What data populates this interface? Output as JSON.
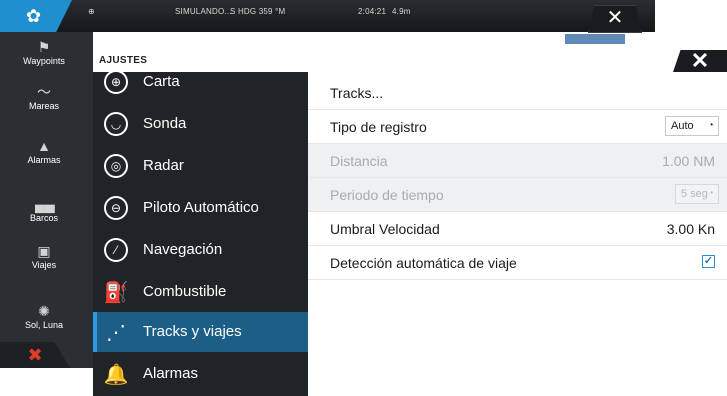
{
  "topbar": {
    "home_icon": "gear-icon",
    "gps_icon": "globe-icon",
    "mode": "SIMULANDO...",
    "hdg_label": "S HDG 359 °M",
    "time": "2:04:21",
    "speed": "4.9m",
    "close_icon": "close-icon"
  },
  "sidebar": {
    "items": [
      {
        "label": "Waypoints",
        "icon": "flag-icon"
      },
      {
        "label": "Mareas",
        "icon": "wave-icon"
      },
      {
        "label": "Alarmas",
        "icon": "bell-icon"
      },
      {
        "label": "Barcos",
        "icon": "ship-icon"
      },
      {
        "label": "Viajes",
        "icon": "trip-icon"
      },
      {
        "label": "Sol, Luna",
        "icon": "sun-icon"
      }
    ],
    "exit_icon": "close-red-icon"
  },
  "dialog": {
    "title": "AJUSTES",
    "close_icon": "close-icon",
    "menu": [
      {
        "label": "Carta",
        "icon": "chart-icon"
      },
      {
        "label": "Sonda",
        "icon": "sonar-icon"
      },
      {
        "label": "Radar",
        "icon": "radar-icon"
      },
      {
        "label": "Piloto Automático",
        "icon": "steering-wheel-icon"
      },
      {
        "label": "Navegación",
        "icon": "compass-icon"
      },
      {
        "label": "Combustible",
        "icon": "fuel-pump-icon"
      },
      {
        "label": "Tracks y viajes",
        "icon": "track-icon",
        "selected": true
      },
      {
        "label": "Alarmas",
        "icon": "bell-icon"
      }
    ],
    "settings": {
      "tracks": {
        "label": "Tracks..."
      },
      "log_type": {
        "label": "Tipo de registro",
        "value": "Auto"
      },
      "distance": {
        "label": "Distancia",
        "value": "1.00 NM"
      },
      "time_period": {
        "label": "Periodo de tiempo",
        "value": "5 seg"
      },
      "speed_threshold": {
        "label": "Umbral Velocidad",
        "value": "3.00 Kn"
      },
      "auto_trip": {
        "label": "Detección automática de viaje",
        "checked": true
      }
    }
  }
}
